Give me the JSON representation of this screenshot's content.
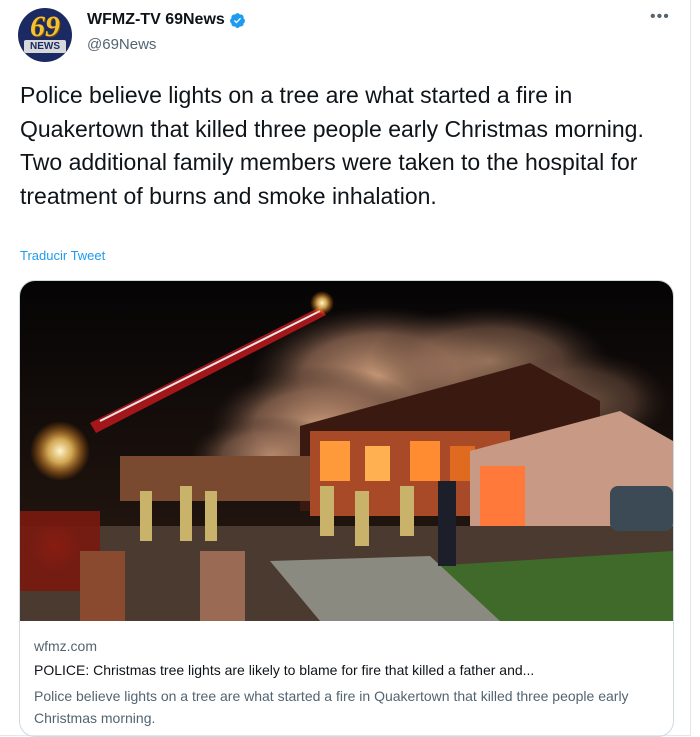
{
  "author": {
    "avatar_number": "69",
    "avatar_label": "NEWS",
    "display_name": "WFMZ-TV 69News",
    "handle": "@69News",
    "verified_icon": "verified-badge-icon",
    "more_icon": "more-options-icon"
  },
  "tweet": {
    "text": "Police believe lights on a tree are what started a fire in Quakertown that killed three people early Christmas morning. Two additional family members were taken to the hospital for treatment of burns and smoke inhalation.",
    "translate_label": "Traducir Tweet"
  },
  "card": {
    "domain": "wfmz.com",
    "title": "POLICE: Christmas tree lights are likely to blame for fire that killed a father and...",
    "description": "Police believe lights on a tree are what started a fire in Quakertown that killed three people early Christmas morning."
  },
  "colors": {
    "link": "#1d9bf0",
    "verified": "#1d9bf0",
    "secondary_text": "#536471"
  }
}
